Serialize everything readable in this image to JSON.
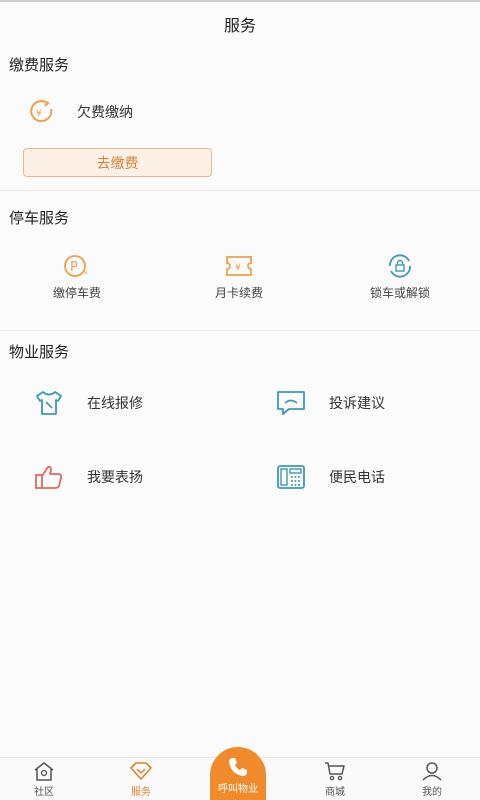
{
  "header": {
    "title": "服务"
  },
  "fee_section": {
    "title": "缴费服务",
    "item_label": "欠费缴纳",
    "button_label": "去缴费"
  },
  "parking_section": {
    "title": "停车服务",
    "items": [
      {
        "label": "缴停车费",
        "icon": "parking-p-icon"
      },
      {
        "label": "月卡续费",
        "icon": "ticket-icon"
      },
      {
        "label": "锁车或解锁",
        "icon": "car-lock-icon"
      }
    ]
  },
  "property_section": {
    "title": "物业服务",
    "items": [
      {
        "label": "在线报修",
        "icon": "shirt-repair-icon"
      },
      {
        "label": "投诉建议",
        "icon": "chat-bubble-icon"
      },
      {
        "label": "我要表扬",
        "icon": "thumbs-up-icon"
      },
      {
        "label": "便民电话",
        "icon": "telephone-icon"
      }
    ]
  },
  "tabbar": {
    "tabs": [
      {
        "label": "社区",
        "icon": "home-icon"
      },
      {
        "label": "服务",
        "icon": "diamond-icon",
        "active": true
      },
      {
        "label": "呼叫物业",
        "icon": "phone-icon"
      },
      {
        "label": "商城",
        "icon": "cart-icon"
      },
      {
        "label": "我的",
        "icon": "user-icon"
      }
    ]
  },
  "colors": {
    "accent": "#f08a2a",
    "teal": "#3a9bb3",
    "salmon": "#e06a5a"
  }
}
